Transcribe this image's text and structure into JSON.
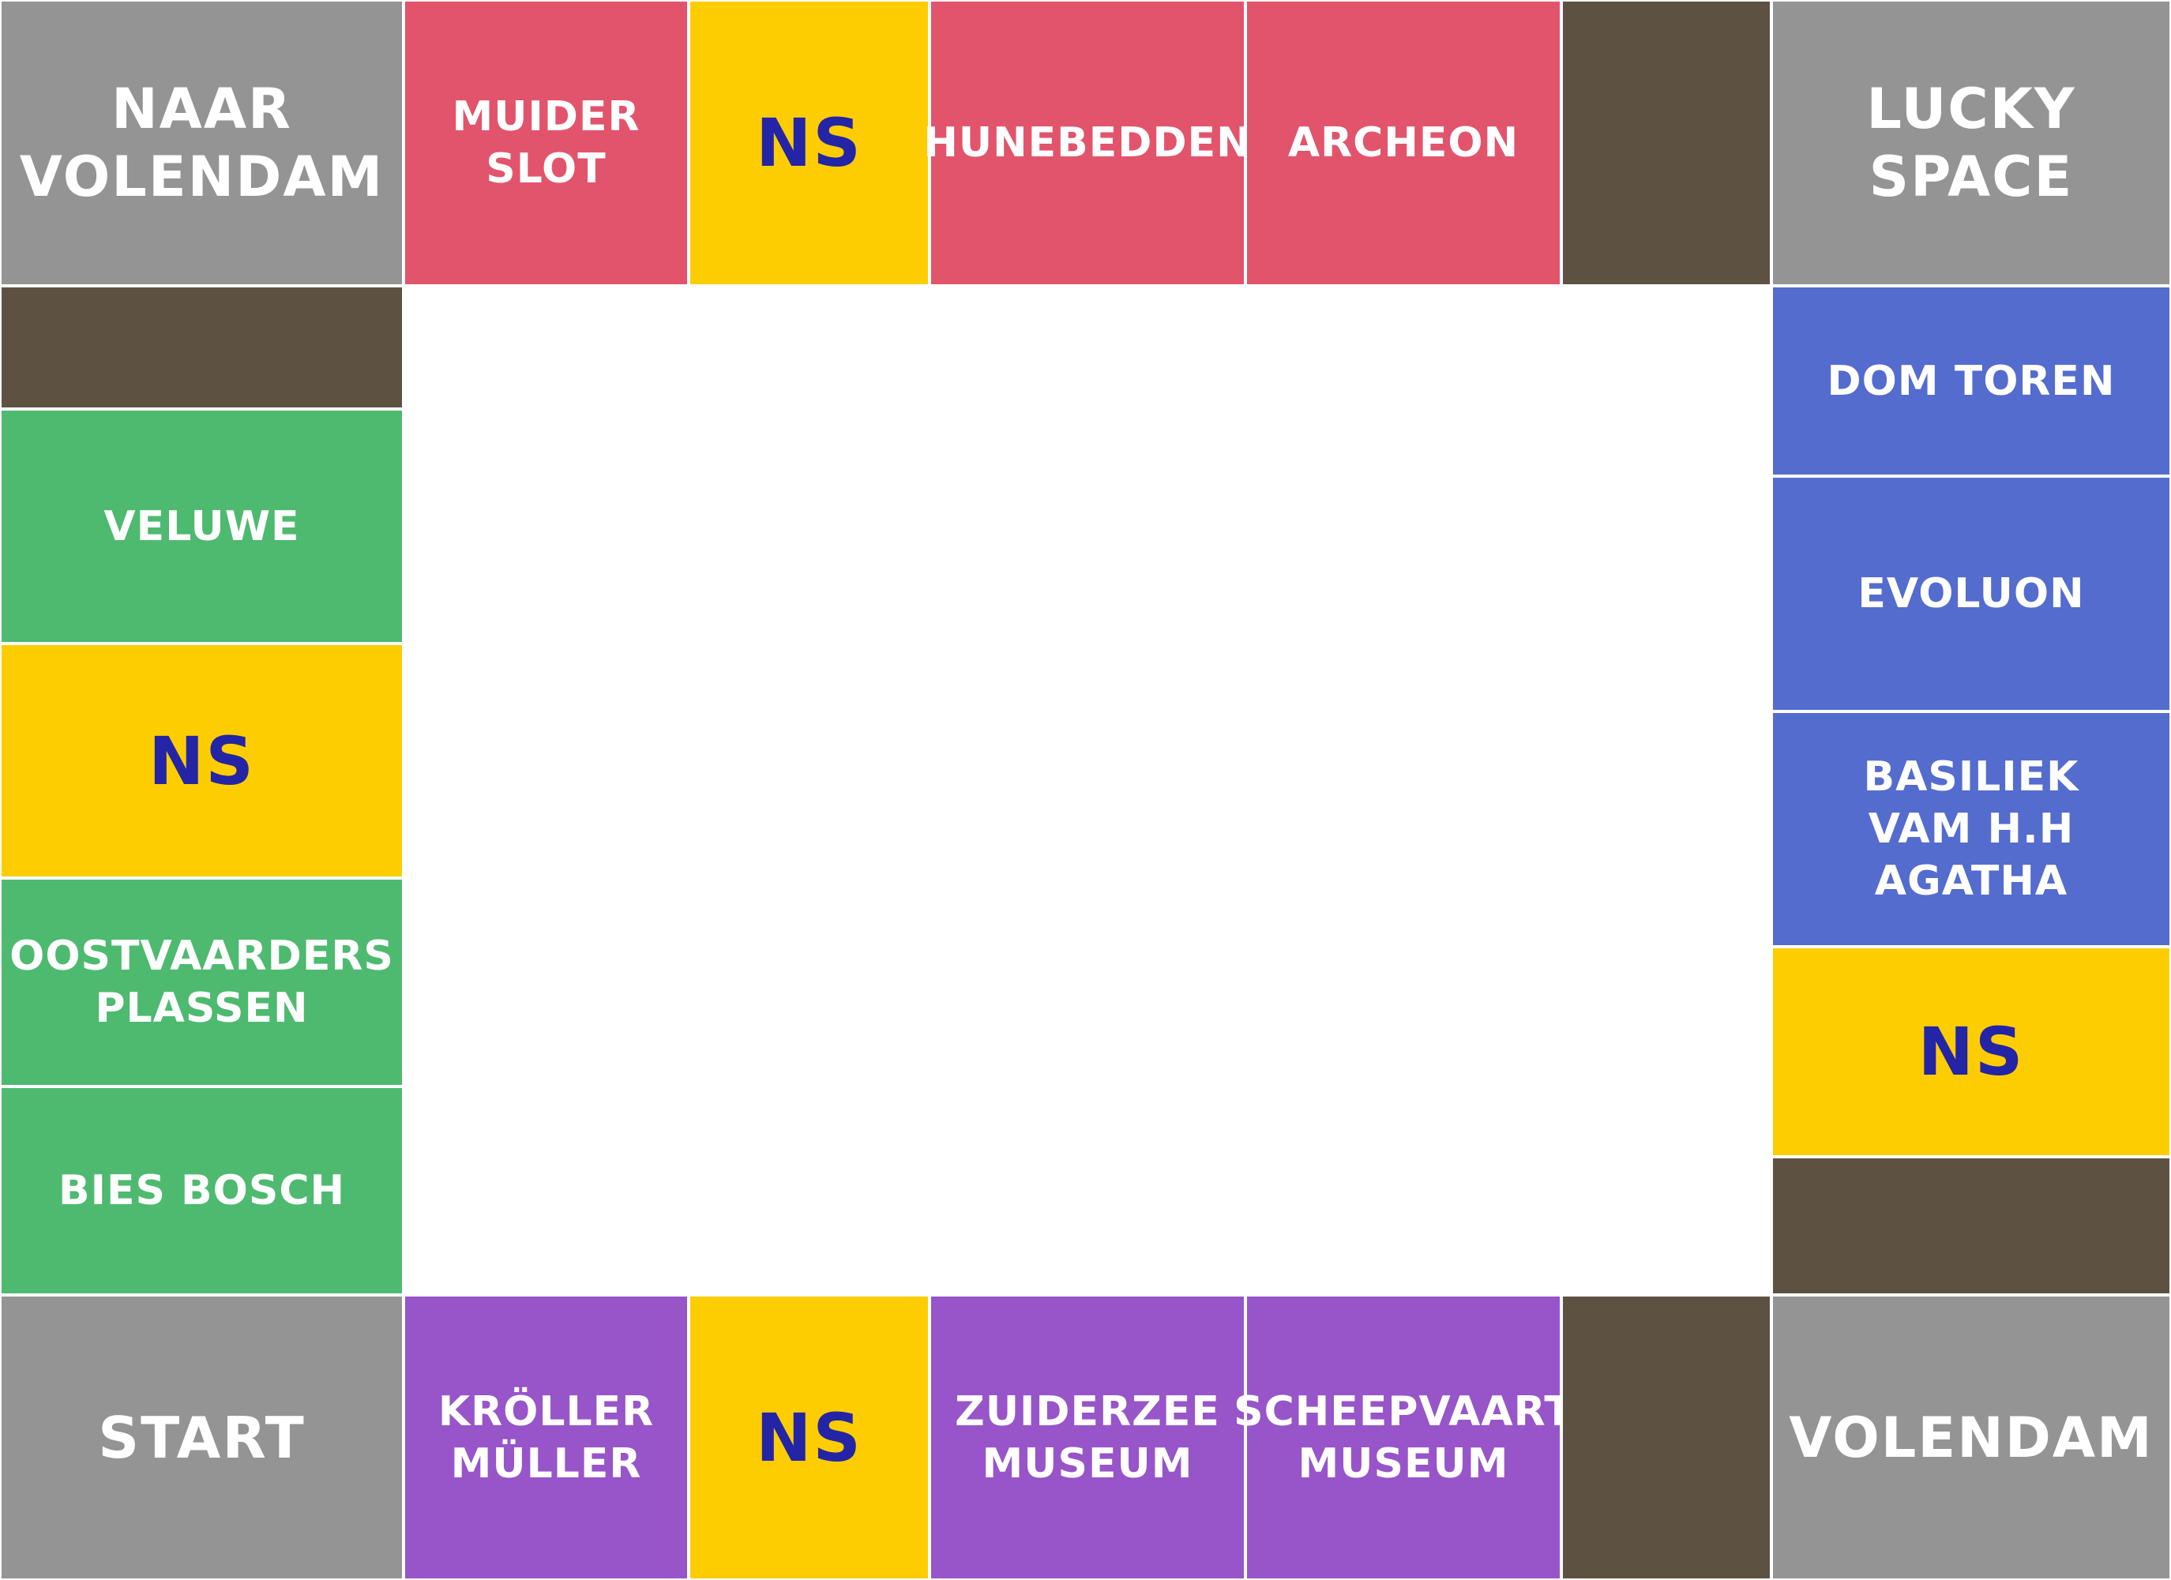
{
  "colors": {
    "corner": "#949494",
    "station": "#fecd01",
    "station_text": "#2424a6",
    "red": "#e2546c",
    "brown": "#5d5242",
    "green": "#4dba6f",
    "blue": "#546cce",
    "purple": "#9755c9",
    "text": "#ffffff",
    "background": "#ffffff"
  },
  "top_row": [
    {
      "label": "NAAR\nVOLENDAM",
      "group": "corner"
    },
    {
      "label": "MUIDER\nSLOT",
      "group": "red"
    },
    {
      "label": "NS",
      "group": "station"
    },
    {
      "label": "HUNEBEDDEN",
      "group": "red"
    },
    {
      "label": "ARCHEON",
      "group": "red"
    },
    {
      "label": "",
      "group": "brown"
    },
    {
      "label": "LUCKY\nSPACE",
      "group": "corner"
    }
  ],
  "left_column": [
    {
      "label": "",
      "group": "brown"
    },
    {
      "label": "VELUWE",
      "group": "green"
    },
    {
      "label": "NS",
      "group": "station"
    },
    {
      "label": "OOSTVAARDERS\nPLASSEN",
      "group": "green"
    },
    {
      "label": "BIES BOSCH",
      "group": "green"
    }
  ],
  "right_column": [
    {
      "label": "DOM TOREN",
      "group": "blue"
    },
    {
      "label": "EVOLUON",
      "group": "blue"
    },
    {
      "label": "BASILIEK\nVAM H.H\nAGATHA",
      "group": "blue"
    },
    {
      "label": "NS",
      "group": "station"
    },
    {
      "label": "",
      "group": "brown"
    }
  ],
  "bottom_row": [
    {
      "label": "START",
      "group": "corner"
    },
    {
      "label": "KRÖLLER\nMÜLLER",
      "group": "purple"
    },
    {
      "label": "NS",
      "group": "station"
    },
    {
      "label": "ZUIDERZEE\nMUSEUM",
      "group": "purple"
    },
    {
      "label": "SCHEEPVAART\nMUSEUM",
      "group": "purple"
    },
    {
      "label": "",
      "group": "brown"
    },
    {
      "label": "VOLENDAM",
      "group": "corner"
    }
  ]
}
